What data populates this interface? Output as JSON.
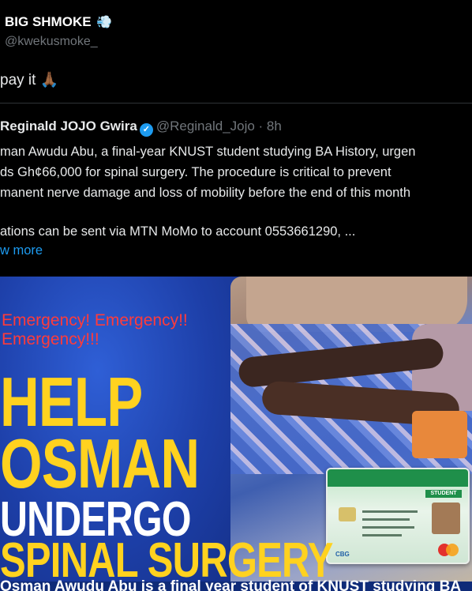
{
  "tweet": {
    "author_name": "BIG SHMOKE",
    "author_emoji": "💨",
    "author_handle": "@kwekusmoke_",
    "text": "pay it 🙏🏾"
  },
  "quoted": {
    "author_name": "Reginald JOJO Gwira",
    "verified_icon": "verified-badge-icon",
    "handle_time": "@Reginald_Jojo · 8h",
    "lines": [
      "man Awudu Abu, a final-year KNUST student studying BA History, urgen",
      "ds Gh¢66,000 for spinal surgery. The procedure is critical to prevent",
      "manent nerve damage and loss of mobility before the end of this month",
      "ations can be sent via MTN MoMo to account 0553661290,  ..."
    ],
    "show_more": "w more"
  },
  "media": {
    "emergency_line1": "Emergency! Emergency!!",
    "emergency_line2": "Emergency!!!",
    "help": "HELP",
    "osman": "OSMAN",
    "undergo": "UNDERGO",
    "spinal_surgery": "SPINAL SURGERY",
    "bottom_text": "Osman Awudu Abu is a final year student of KNUST studying BA",
    "card_label": "STUDENT",
    "card_bank": "CBG"
  },
  "colors": {
    "background": "#000000",
    "link": "#1d9bf0",
    "poster_blue": "#1d3fa8",
    "poster_yellow": "#ffd21f",
    "poster_red": "#ff3b3b"
  }
}
